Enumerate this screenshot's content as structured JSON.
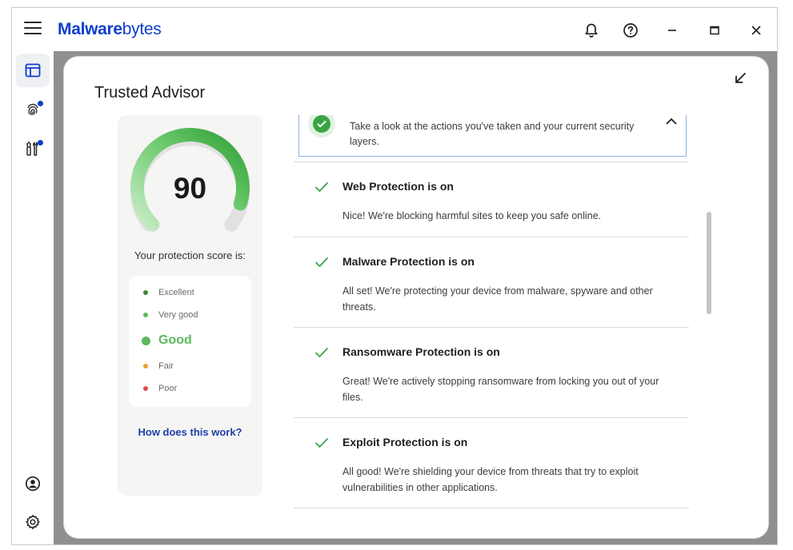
{
  "app": {
    "logo_prefix": "M",
    "logo_bold": "alware",
    "logo_rest": "bytes"
  },
  "titlebar": {
    "icons": [
      "hamburger-menu-icon",
      "bell-icon",
      "help-icon",
      "minimize-icon",
      "maximize-icon",
      "close-icon"
    ]
  },
  "sidebar": {
    "items": [
      {
        "name": "dashboard",
        "icon": "dashboard-icon",
        "active": true
      },
      {
        "name": "identity",
        "icon": "fingerprint-icon",
        "badge": true
      },
      {
        "name": "tools",
        "icon": "tools-icon",
        "badge": true
      },
      {
        "name": "account",
        "icon": "account-icon"
      },
      {
        "name": "settings",
        "icon": "gear-icon"
      }
    ]
  },
  "modal": {
    "title": "Trusted Advisor",
    "score": {
      "value": "90",
      "label": "Your protection score is:",
      "gauge_fraction": 0.9
    },
    "levels": [
      {
        "label": "Excellent",
        "color": "#3a8a3a",
        "current": false
      },
      {
        "label": "Very good",
        "color": "#5cb85c",
        "current": false
      },
      {
        "label": "Good",
        "color": "#5cb85c",
        "current": true
      },
      {
        "label": "Fair",
        "color": "#f0a030",
        "current": false
      },
      {
        "label": "Poor",
        "color": "#e24a4a",
        "current": false
      }
    ],
    "how_link": "How does this work?",
    "summary_text": "Take a look at the actions you've taken and your current security layers.",
    "items": [
      {
        "title": "Web Protection is on",
        "desc": "Nice! We're blocking harmful sites to keep you safe online."
      },
      {
        "title": "Malware Protection is on",
        "desc": "All set! We're protecting your device from malware, spyware and other threats."
      },
      {
        "title": "Ransomware Protection is on",
        "desc": "Great! We're actively stopping ransomware from locking you out of your files."
      },
      {
        "title": "Exploit Protection is on",
        "desc": "All good! We're shielding your device from threats that try to exploit vulnerabilities in other applications."
      }
    ]
  },
  "colors": {
    "brand": "#0d3ecc",
    "check_green": "#3aa344",
    "link": "#1f3fa8"
  }
}
